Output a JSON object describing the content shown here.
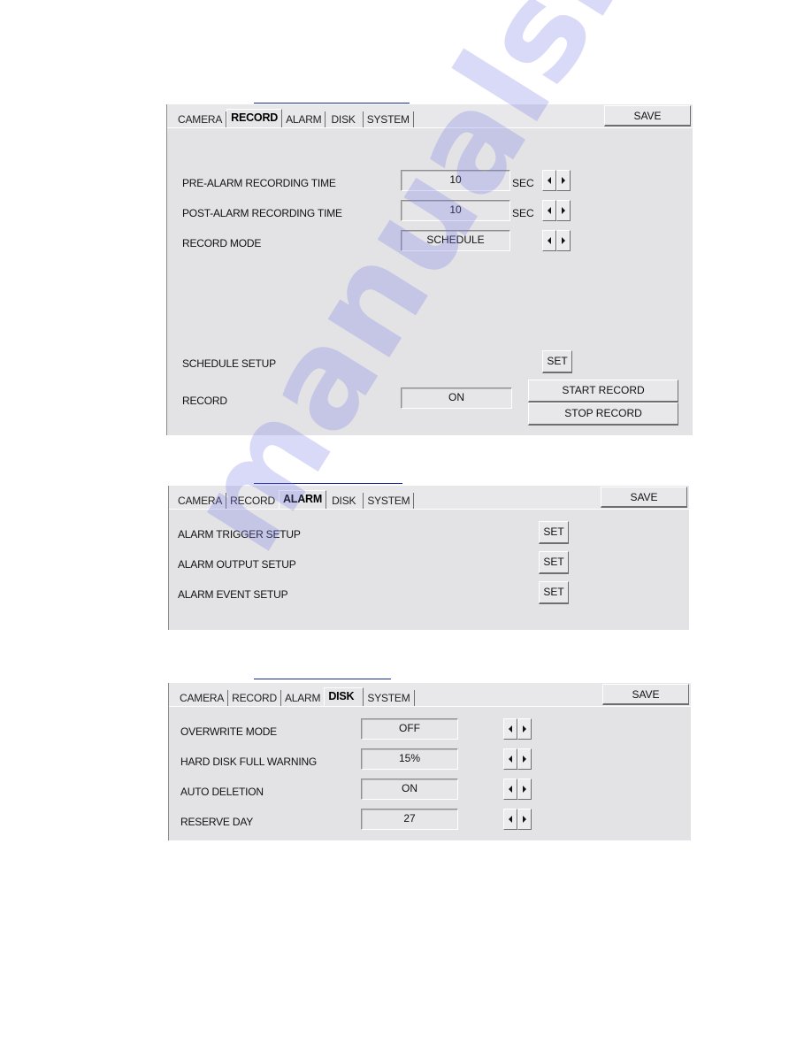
{
  "panels": {
    "record": {
      "tabs": [
        "CAMERA",
        "RECORD",
        "ALARM",
        "DISK",
        "SYSTEM"
      ],
      "active_tab": "RECORD",
      "save_label": "SAVE",
      "rows": [
        {
          "label": "PRE-ALARM RECORDING TIME",
          "value": "10",
          "unit": "SEC"
        },
        {
          "label": "POST-ALARM RECORDING TIME",
          "value": "10",
          "unit": "SEC"
        },
        {
          "label": "RECORD MODE",
          "value": "SCHEDULE",
          "unit": ""
        }
      ],
      "schedule_setup_label": "SCHEDULE SETUP",
      "set_label": "SET",
      "record_label": "RECORD",
      "record_value": "ON",
      "start_record_label": "START RECORD",
      "stop_record_label": "STOP RECORD"
    },
    "alarm": {
      "tabs": [
        "CAMERA",
        "RECORD",
        "ALARM",
        "DISK",
        "SYSTEM"
      ],
      "active_tab": "ALARM",
      "save_label": "SAVE",
      "rows": [
        {
          "label": "ALARM TRIGGER SETUP",
          "button": "SET"
        },
        {
          "label": "ALARM OUTPUT SETUP",
          "button": "SET"
        },
        {
          "label": "ALARM EVENT SETUP",
          "button": "SET"
        }
      ]
    },
    "disk": {
      "tabs": [
        "CAMERA",
        "RECORD",
        "ALARM",
        "DISK",
        "SYSTEM"
      ],
      "active_tab": "DISK",
      "save_label": "SAVE",
      "rows": [
        {
          "label": "OVERWRITE MODE",
          "value": "OFF"
        },
        {
          "label": "HARD DISK FULL WARNING",
          "value": "15%"
        },
        {
          "label": "AUTO DELETION",
          "value": "ON"
        },
        {
          "label": "RESERVE DAY",
          "value": "27"
        }
      ]
    }
  },
  "watermark": "manualshive.com"
}
